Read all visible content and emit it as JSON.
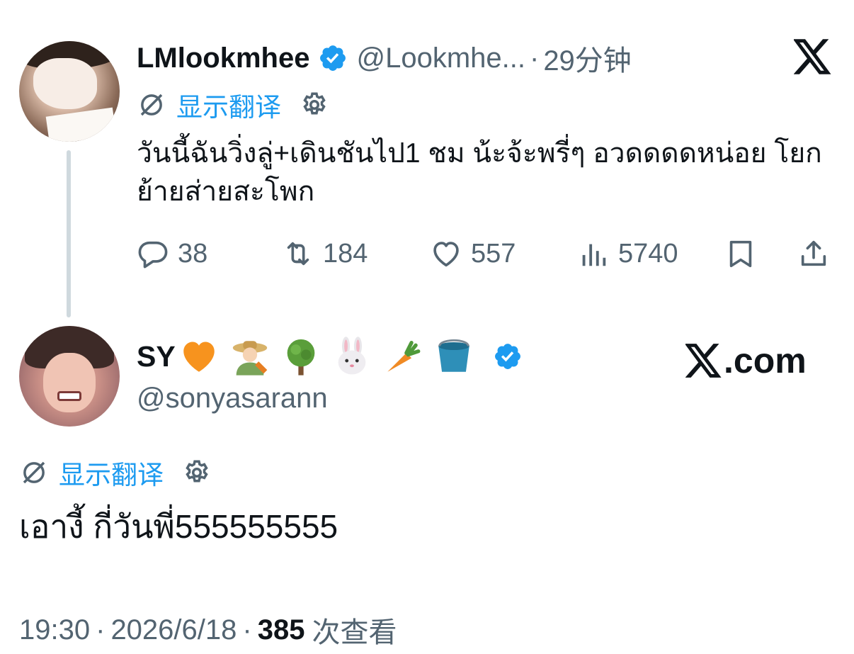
{
  "colors": {
    "text": "#0f1419",
    "secondary": "#536471",
    "accent": "#1d9bf0",
    "thread_line": "#cfd9de"
  },
  "parent_tweet": {
    "display_name": "LMlookmhee",
    "handle": "@Lookmhe...",
    "separator": "·",
    "time": "29分钟",
    "translate_label": "显示翻译",
    "text": "วันนี้ฉันวิ่งลู่+เดินชันไป1 ชม น้ะจ้ะพรี่ๆ อวดดดดหน่อย โยกย้ายส่ายสะโพก",
    "actions": {
      "replies": "38",
      "retweets": "184",
      "likes": "557",
      "views": "5740"
    },
    "icons": [
      "verified-badge-icon",
      "x-logo-icon",
      "globe-icon",
      "gear-icon",
      "reply-icon",
      "retweet-icon",
      "like-icon",
      "views-icon",
      "bookmark-icon",
      "share-icon"
    ]
  },
  "reply_tweet": {
    "display_name": "SY",
    "name_emojis": [
      "orange-heart",
      "farmer",
      "tree",
      "rabbit-face",
      "carrot",
      "bucket"
    ],
    "handle": "@sonyasarann",
    "watermark": ".com",
    "translate_label": "显示翻译",
    "text": "เอางี้ กี่วันพี่555555555",
    "meta": {
      "time": "19:30",
      "separator": "·",
      "date": "2026/6/18",
      "views_count": "385",
      "views_label": "次查看"
    }
  }
}
